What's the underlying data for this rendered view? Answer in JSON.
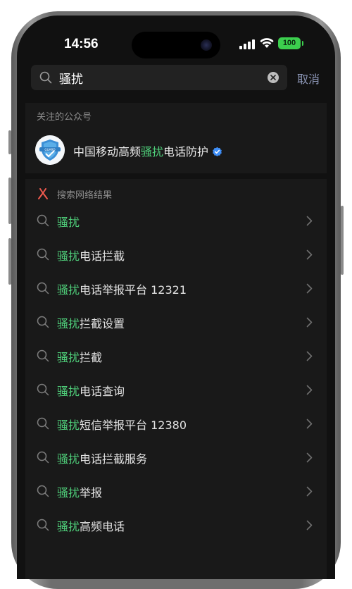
{
  "status_bar": {
    "time": "14:56",
    "battery": "100",
    "battery_color": "#3ccf4e"
  },
  "search": {
    "query": "骚扰",
    "cancel_label": "取消"
  },
  "followed_accounts": {
    "header": "关注的公众号",
    "account": {
      "name_prefix": "中国移动高频",
      "name_highlight": "骚扰",
      "name_suffix": "电话防护",
      "verified": true,
      "avatar_text": "GUARD"
    }
  },
  "web_results": {
    "header": "搜索网络结果",
    "highlight_color": "#4fcf7a",
    "items": [
      {
        "highlight": "骚扰",
        "rest": ""
      },
      {
        "highlight": "骚扰",
        "rest": "电话拦截"
      },
      {
        "highlight": "骚扰",
        "rest": "电话举报平台 12321"
      },
      {
        "highlight": "骚扰",
        "rest": "拦截设置"
      },
      {
        "highlight": "骚扰",
        "rest": "拦截"
      },
      {
        "highlight": "骚扰",
        "rest": "电话查询"
      },
      {
        "highlight": "骚扰",
        "rest": "短信举报平台 12380"
      },
      {
        "highlight": "骚扰",
        "rest": "电话拦截服务"
      },
      {
        "highlight": "骚扰",
        "rest": "举报"
      },
      {
        "highlight": "骚扰",
        "rest": "高频电话"
      }
    ]
  }
}
